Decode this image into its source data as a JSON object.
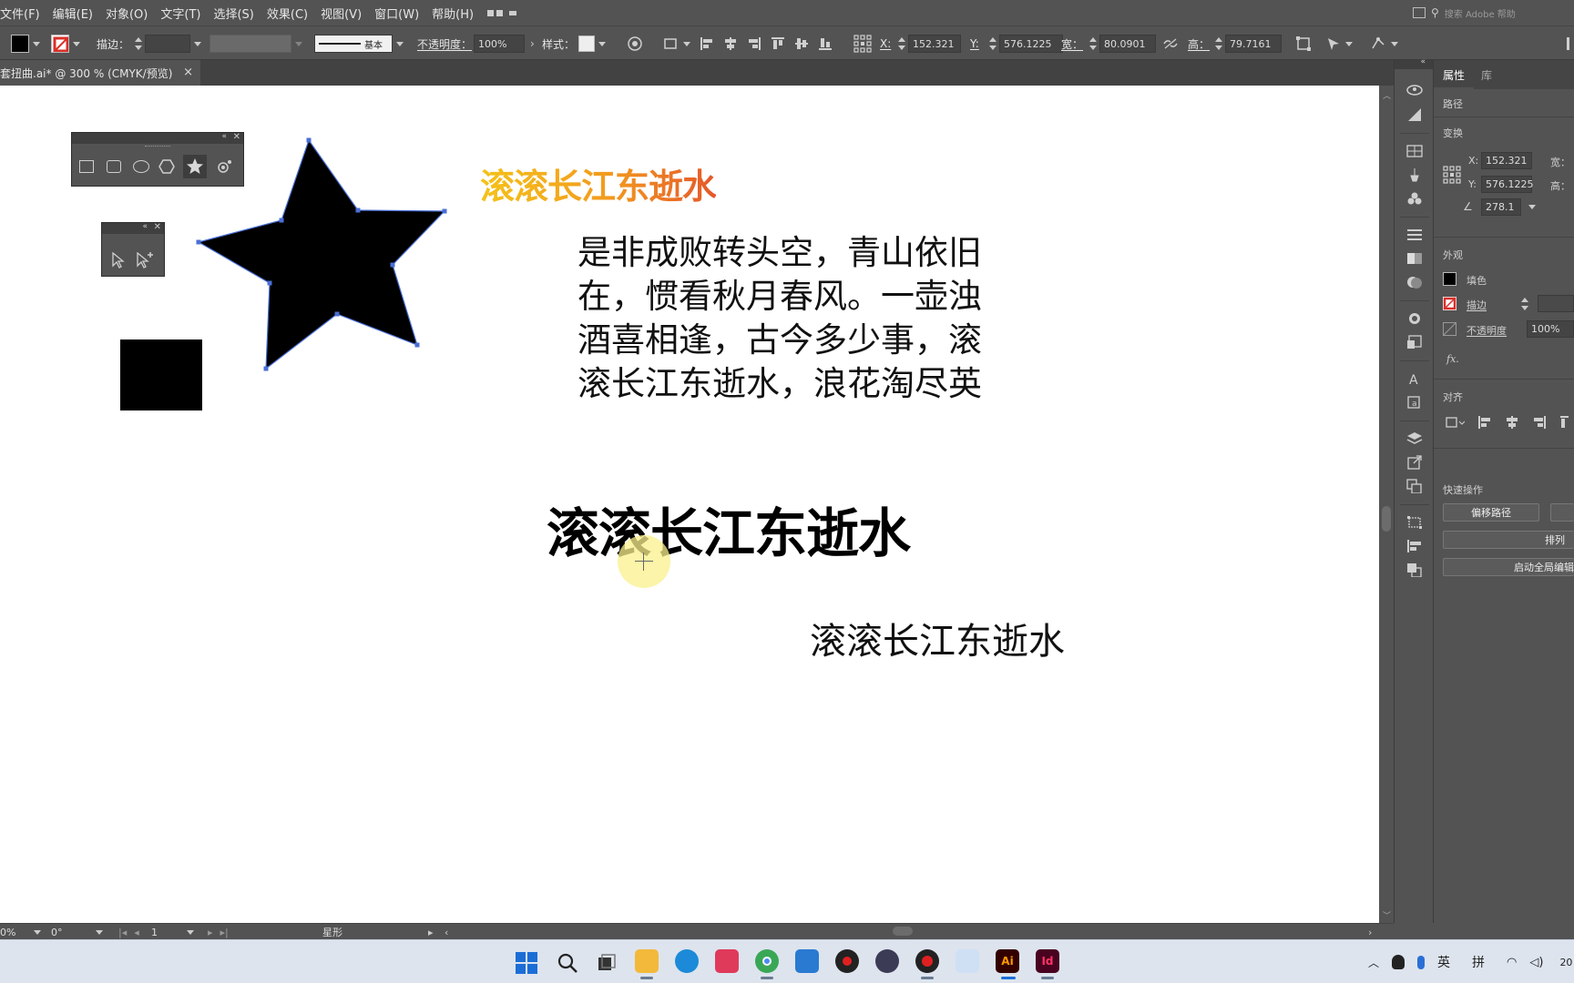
{
  "menu": {
    "items": [
      "文件(F)",
      "编辑(E)",
      "对象(O)",
      "文字(T)",
      "选择(S)",
      "效果(C)",
      "视图(V)",
      "窗口(W)",
      "帮助(H)"
    ],
    "search_placeholder": "搜索 Adobe 帮助"
  },
  "control": {
    "stroke_label": "描边：",
    "profile_label": "基本",
    "opacity_label": "不透明度：",
    "opacity_value": "100%",
    "style_label": "样式：",
    "x_label": "X:",
    "x_value": "152.321",
    "y_label": "Y:",
    "y_value": "576.1225",
    "w_label": "宽：",
    "w_value": "80.0901",
    "h_label": "高：",
    "h_value": "79.7161"
  },
  "document": {
    "tab_title": "套扭曲.ai* @ 300 % (CMYK/预览)",
    "close": "×"
  },
  "canvas": {
    "gradient_text": "滚滚长江东逝水",
    "paragraph_lines": [
      "是非成败转头空，青山依旧",
      "在，惯看秋月春风。一壶浊",
      "酒喜相逢，古今多少事，滚",
      "滚长江东逝水，浪花淘尽英"
    ],
    "bold_text": "滚滚长江东逝水",
    "small_text": "滚滚长江东逝水"
  },
  "panel": {
    "tabs": [
      "属性",
      "库"
    ],
    "path_label": "路径",
    "transform_label": "变换",
    "x_label": "X:",
    "x_value": "152.321",
    "y_label": "Y:",
    "y_value": "576.1225",
    "w_label": "宽：",
    "h_label": "高：",
    "angle_value": "278.1",
    "appearance_label": "外观",
    "fill_label": "填色",
    "stroke_label": "描边",
    "opacity_label": "不透明度",
    "opacity_value": "100%",
    "fx_label": "fx.",
    "align_label": "对齐",
    "quick_actions_label": "快速操作",
    "offset_path_btn": "偏移路径",
    "arrange_btn": "排列",
    "global_edit_btn": "启动全局编辑"
  },
  "status": {
    "zoom": "0%",
    "rotation": "0°",
    "artboard": "1",
    "tool": "星形"
  },
  "taskbar": {
    "ime_lang": "英",
    "ime_mode": "拼",
    "ai_label": "Ai",
    "id_label": "Id",
    "clock": "20"
  },
  "colors": {
    "ui_bg": "#535353",
    "canvas_bg": "#ffffff",
    "selection": "#4a6fd6",
    "gradient_start": "#f5c21a",
    "gradient_end": "#e5572b",
    "ai_brand": "#330000",
    "id_brand": "#49021f"
  }
}
